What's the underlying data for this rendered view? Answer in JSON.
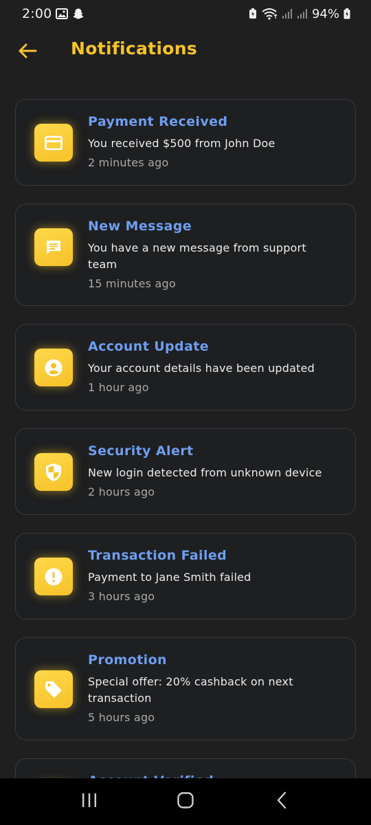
{
  "status_bar": {
    "time": "2:00",
    "battery": "94%"
  },
  "header": {
    "title": "Notifications",
    "back_icon": "arrow-left-icon"
  },
  "colors": {
    "accent": "#f7c427",
    "title_blue": "#6e9ef0",
    "background": "#1f1f1f"
  },
  "notifications": [
    {
      "title": "Payment Received",
      "message": "You received $500 from John Doe",
      "time": "2 minutes ago",
      "icon": "card-icon"
    },
    {
      "title": "New Message",
      "message": "You have a new message from support team",
      "time": "15 minutes ago",
      "icon": "message-icon"
    },
    {
      "title": "Account Update",
      "message": "Your account details have been updated",
      "time": "1 hour ago",
      "icon": "account-circle-icon"
    },
    {
      "title": "Security Alert",
      "message": "New login detected from unknown device",
      "time": "2 hours ago",
      "icon": "shield-icon"
    },
    {
      "title": "Transaction Failed",
      "message": "Payment to Jane Smith failed",
      "time": "3 hours ago",
      "icon": "alert-icon"
    },
    {
      "title": "Promotion",
      "message": "Special offer: 20% cashback on next transaction",
      "time": "5 hours ago",
      "icon": "tag-icon"
    },
    {
      "title": "Account Verified",
      "icon": "verified-icon"
    }
  ]
}
